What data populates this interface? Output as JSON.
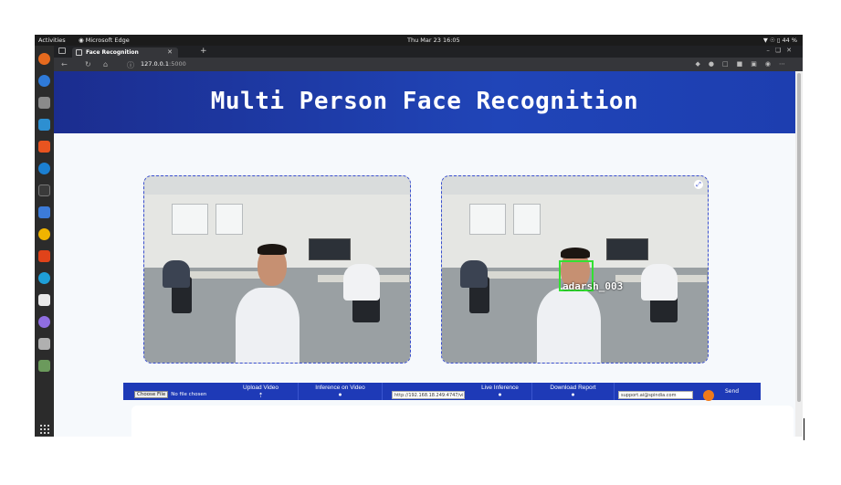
{
  "system": {
    "activities": "Activities",
    "app_name": "Microsoft Edge",
    "clock": "Thu Mar 23  16:05",
    "battery": "44 %"
  },
  "browser": {
    "tab_title": "Face Recognition",
    "url_host": "127.0.0.1",
    "url_port": ":5000"
  },
  "page": {
    "title": "Multi Person Face Recognition",
    "detection_label": "adarsh_003",
    "controls": {
      "choose_file": "Choose File",
      "no_file": "No file chosen",
      "upload_video": "Upload Video",
      "inference_video": "Inference on Video",
      "stream_url": "http://192.168.18.249:4747/vi",
      "live_inference": "Live Inference",
      "download_report": "Download Report",
      "email": "support.ai@spindia.com",
      "send": "Send"
    }
  },
  "colors": {
    "header": "#1f3bb3",
    "panel_border": "#3a4fcf",
    "bbox": "#32e132",
    "controls_bg": "#1e3ab7"
  }
}
